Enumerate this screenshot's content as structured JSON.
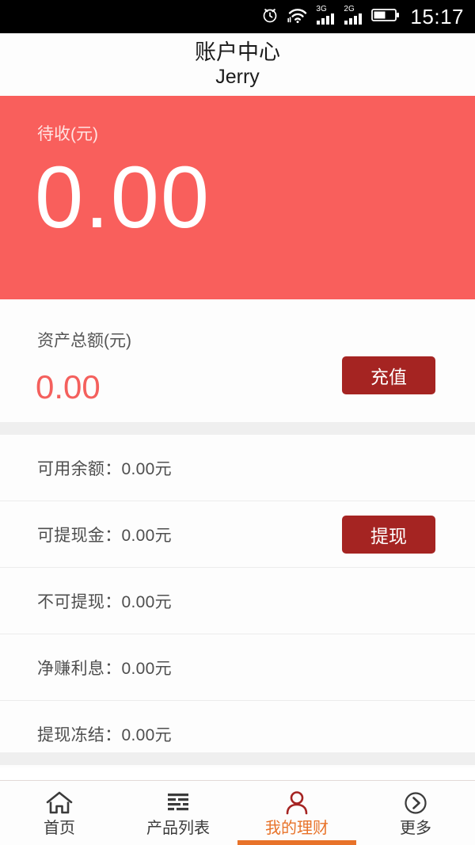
{
  "statusbar": {
    "time": "15:17",
    "icons": [
      "alarm-icon",
      "wifi-icon",
      "signal-3g-icon",
      "signal-2g-icon",
      "battery-icon"
    ],
    "net_labels": {
      "primary": "3G",
      "secondary": "2G"
    }
  },
  "header": {
    "title": "账户中心",
    "subtitle": "Jerry"
  },
  "banner": {
    "label": "待收(元)",
    "amount": "0.00",
    "color": "#f95f5c"
  },
  "assets": {
    "label": "资产总额(元)",
    "amount": "0.00",
    "amount_color": "#f4605d",
    "recharge_label": "充值",
    "button_color": "#a52422"
  },
  "rows": [
    {
      "text": "可用余额：0.00元",
      "action": null
    },
    {
      "text": "可提现金：0.00元",
      "action": "提现"
    },
    {
      "text": "不可提现：0.00元",
      "action": null
    },
    {
      "text": "净赚利息：0.00元",
      "action": null
    },
    {
      "text": "提现冻结：0.00元",
      "action": null
    }
  ],
  "tabbar": {
    "active_color": "#e8732a",
    "items": [
      {
        "label": "首页",
        "icon": "home-icon",
        "active": false
      },
      {
        "label": "产品列表",
        "icon": "list-icon",
        "active": false
      },
      {
        "label": "我的理财",
        "icon": "person-icon",
        "active": true
      },
      {
        "label": "更多",
        "icon": "chevron-right-circle-icon",
        "active": false
      }
    ]
  }
}
